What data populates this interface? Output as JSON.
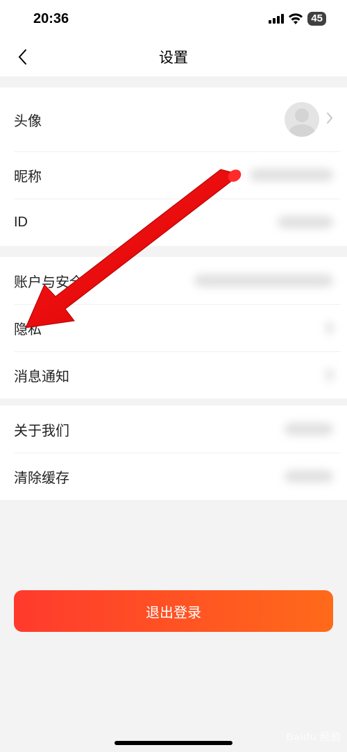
{
  "status": {
    "time": "20:36",
    "battery": "45"
  },
  "header": {
    "title": "设置"
  },
  "rows": {
    "avatar": "头像",
    "nickname": "昵称",
    "id": "ID",
    "account_security": "账户与安全",
    "privacy": "隐私",
    "notifications": "消息通知",
    "about": "关于我们",
    "clear_cache": "清除缓存"
  },
  "logout": "退出登录",
  "watermark": "Baidu 经验",
  "annotation": {
    "type": "arrow",
    "color": "#ff0000",
    "points_to": "privacy-row"
  }
}
